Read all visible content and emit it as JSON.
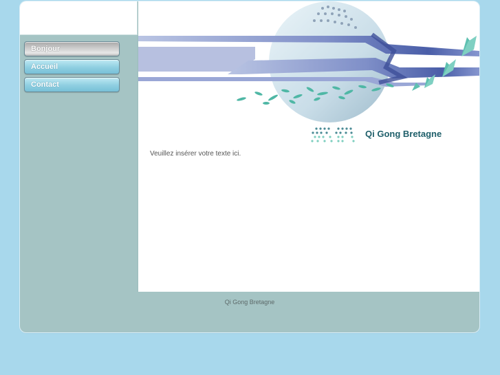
{
  "nav": {
    "items": [
      {
        "label": "Bonjour"
      },
      {
        "label": "Accueil"
      },
      {
        "label": "Contact"
      }
    ]
  },
  "header": {
    "site_title": "Qi Gong Bretagne"
  },
  "main": {
    "body_text": "Veuillez insérer votre texte ici."
  },
  "footer": {
    "text": "Qi Gong Bretagne"
  },
  "colors": {
    "page_background": "#a8d8ec",
    "sidebar": "#a5c4c4",
    "title_text": "#1f5f6a",
    "banner_stripes": "#5a6fb3",
    "butterflies": "#5ec0b0"
  },
  "icons": [
    "butterfly-icon",
    "dotted-logo-icon"
  ]
}
